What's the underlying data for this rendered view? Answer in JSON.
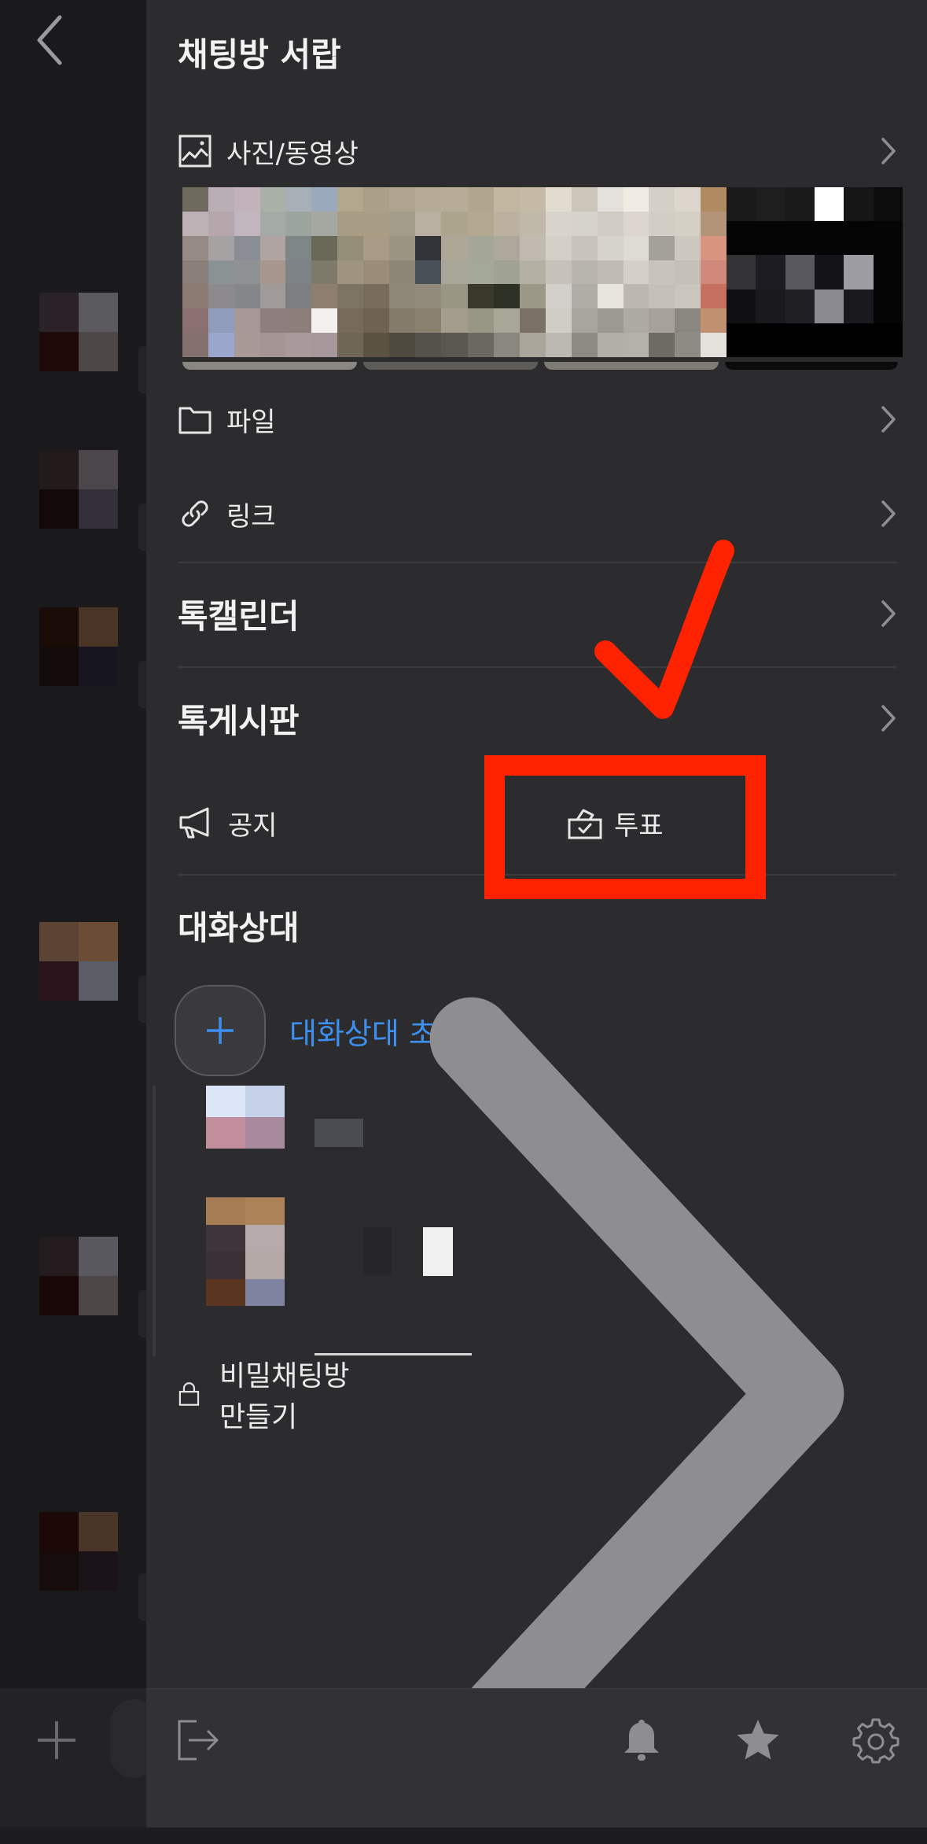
{
  "drawer": {
    "title": "채팅방 서랍",
    "media": {
      "label": "사진/동영상",
      "icon": "image-icon"
    },
    "file": {
      "label": "파일",
      "icon": "folder-icon"
    },
    "link": {
      "label": "링크",
      "icon": "link-icon"
    },
    "calendar": {
      "label": "톡캘린더"
    },
    "board": {
      "label": "톡게시판"
    },
    "notice": {
      "label": "공지",
      "icon": "megaphone-icon"
    },
    "vote": {
      "label": "투표",
      "icon": "ballot-box-icon"
    }
  },
  "members": {
    "title": "대화상대",
    "invite_label": "대화상대 초대"
  },
  "secret_chat": {
    "label": "비밀채팅방 만들기",
    "icon": "lock-icon"
  },
  "bottom_bar": {
    "icons": [
      "exit-icon",
      "bell-icon",
      "star-icon",
      "gear-icon"
    ]
  },
  "colors": {
    "drawer_bg": "#2c2c2e",
    "accent_blue": "#3d8ff0",
    "annotation_red": "#ff2200"
  }
}
